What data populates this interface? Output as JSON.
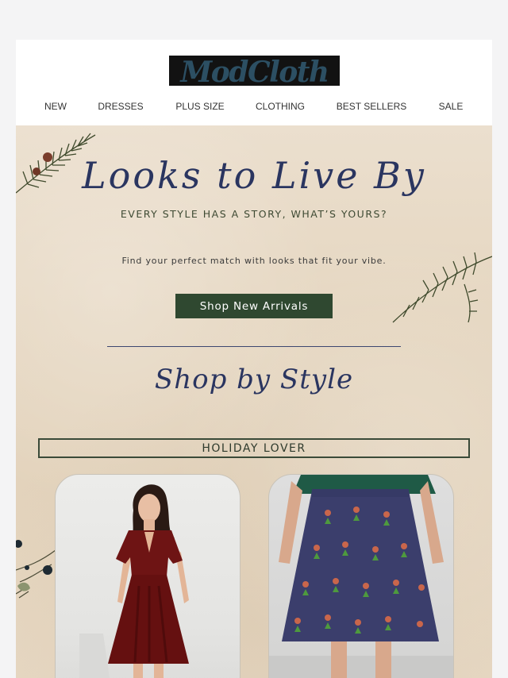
{
  "brand": {
    "logo_text": "ModCloth"
  },
  "nav": {
    "items": [
      {
        "label": "NEW"
      },
      {
        "label": "DRESSES"
      },
      {
        "label": "PLUS SIZE"
      },
      {
        "label": "CLOTHING"
      },
      {
        "label": "BEST SELLERS"
      },
      {
        "label": "SALE"
      }
    ]
  },
  "hero": {
    "title": "Looks to Live By",
    "subtitle": "EVERY STYLE HAS A STORY, WHAT’S YOURS?",
    "tagline": "Find your perfect match with looks that fit your vibe.",
    "cta_label": "Shop New Arrivals"
  },
  "shop_by_style": {
    "title": "Shop by Style",
    "category_label": "HOLIDAY LOVER",
    "products": [
      {
        "image": "burgundy-velvet-wrap-dress"
      },
      {
        "image": "navy-novelty-print-skirt"
      }
    ]
  },
  "colors": {
    "page_bg": "#f4f4f5",
    "logo_bg": "#121212",
    "logo_text": "#2c4f63",
    "script_navy": "#2a3560",
    "cta_green": "#2f4830",
    "parchment": "#e5d6c0",
    "dress_red": "#6e1414",
    "skirt_navy": "#3b3e6c"
  },
  "icons": [
    "pine-branch-icon",
    "berry-branch-icon"
  ]
}
